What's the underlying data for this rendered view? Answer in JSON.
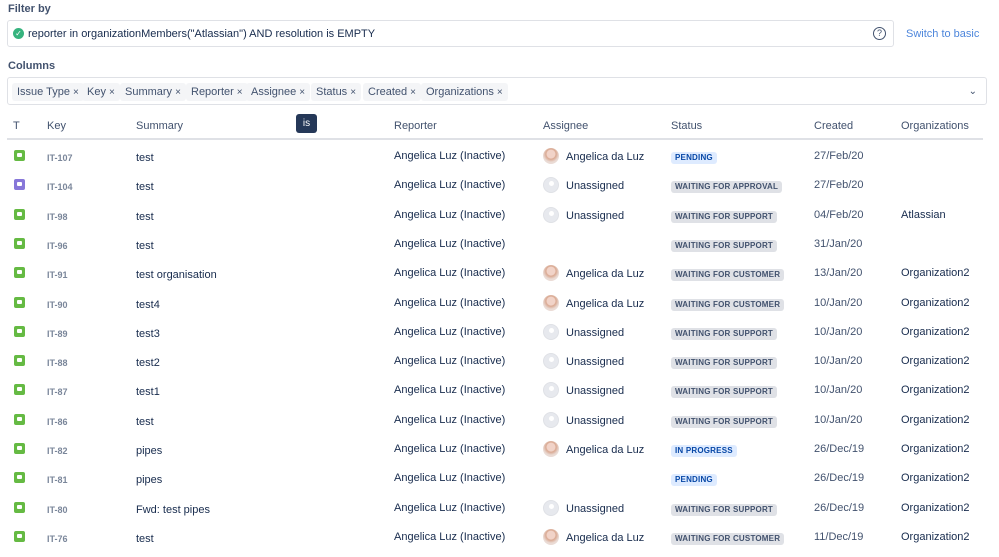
{
  "filter": {
    "label": "Filter by",
    "query": "reporter in organizationMembers(\"Atlassian\") AND resolution is EMPTY",
    "help_icon": "question-circle-icon",
    "switch_label": "Switch to basic"
  },
  "columns": {
    "label": "Columns",
    "chips": [
      "Issue Type",
      "Key",
      "Summary",
      "Reporter",
      "Assignee",
      "Status",
      "Created",
      "Organizations"
    ],
    "remove_glyph": "×"
  },
  "tooltip": {
    "text": "is"
  },
  "table": {
    "headers": {
      "type": "T",
      "key": "Key",
      "summary": "Summary",
      "reporter": "Reporter",
      "assignee": "Assignee",
      "status": "Status",
      "created": "Created",
      "organizations": "Organizations"
    },
    "rows": [
      {
        "type": "green",
        "key": "IT-107",
        "summary": "test",
        "reporter": "Angelica Luz (Inactive)",
        "assignee": "Angelica da Luz",
        "avatar": "photo",
        "status": "PENDING",
        "status_color": "blue",
        "created": "27/Feb/20",
        "organization": ""
      },
      {
        "type": "purple",
        "key": "IT-104",
        "summary": "test",
        "reporter": "Angelica Luz (Inactive)",
        "assignee": "Unassigned",
        "avatar": "default",
        "status": "WAITING FOR APPROVAL",
        "status_color": "grey",
        "created": "27/Feb/20",
        "organization": ""
      },
      {
        "type": "green",
        "key": "IT-98",
        "summary": "test",
        "reporter": "Angelica Luz (Inactive)",
        "assignee": "Unassigned",
        "avatar": "default",
        "status": "WAITING FOR SUPPORT",
        "status_color": "grey",
        "created": "04/Feb/20",
        "organization": "Atlassian"
      },
      {
        "type": "green",
        "key": "IT-96",
        "summary": "test",
        "reporter": "Angelica Luz (Inactive)",
        "assignee": "",
        "avatar": "none",
        "status": "WAITING FOR SUPPORT",
        "status_color": "grey",
        "created": "31/Jan/20",
        "organization": ""
      },
      {
        "type": "green",
        "key": "IT-91",
        "summary": "test organisation",
        "reporter": "Angelica Luz (Inactive)",
        "assignee": "Angelica da Luz",
        "avatar": "photo",
        "status": "WAITING FOR CUSTOMER",
        "status_color": "grey",
        "created": "13/Jan/20",
        "organization": "Organization2"
      },
      {
        "type": "green",
        "key": "IT-90",
        "summary": "test4",
        "reporter": "Angelica Luz (Inactive)",
        "assignee": "Angelica da Luz",
        "avatar": "photo",
        "status": "WAITING FOR CUSTOMER",
        "status_color": "grey",
        "created": "10/Jan/20",
        "organization": "Organization2"
      },
      {
        "type": "green",
        "key": "IT-89",
        "summary": "test3",
        "reporter": "Angelica Luz (Inactive)",
        "assignee": "Unassigned",
        "avatar": "default",
        "status": "WAITING FOR SUPPORT",
        "status_color": "grey",
        "created": "10/Jan/20",
        "organization": "Organization2"
      },
      {
        "type": "green",
        "key": "IT-88",
        "summary": "test2",
        "reporter": "Angelica Luz (Inactive)",
        "assignee": "Unassigned",
        "avatar": "default",
        "status": "WAITING FOR SUPPORT",
        "status_color": "grey",
        "created": "10/Jan/20",
        "organization": "Organization2"
      },
      {
        "type": "green",
        "key": "IT-87",
        "summary": "test1",
        "reporter": "Angelica Luz (Inactive)",
        "assignee": "Unassigned",
        "avatar": "default",
        "status": "WAITING FOR SUPPORT",
        "status_color": "grey",
        "created": "10/Jan/20",
        "organization": "Organization2"
      },
      {
        "type": "green",
        "key": "IT-86",
        "summary": "test",
        "reporter": "Angelica Luz (Inactive)",
        "assignee": "Unassigned",
        "avatar": "default",
        "status": "WAITING FOR SUPPORT",
        "status_color": "grey",
        "created": "10/Jan/20",
        "organization": "Organization2"
      },
      {
        "type": "green",
        "key": "IT-82",
        "summary": "pipes",
        "reporter": "Angelica Luz (Inactive)",
        "assignee": "Angelica da Luz",
        "avatar": "photo",
        "status": "IN PROGRESS",
        "status_color": "blue",
        "created": "26/Dec/19",
        "organization": "Organization2"
      },
      {
        "type": "green",
        "key": "IT-81",
        "summary": "pipes",
        "reporter": "Angelica Luz (Inactive)",
        "assignee": "",
        "avatar": "none",
        "status": "PENDING",
        "status_color": "blue",
        "created": "26/Dec/19",
        "organization": "Organization2"
      },
      {
        "type": "green",
        "key": "IT-80",
        "summary": "Fwd: test pipes",
        "reporter": "Angelica Luz (Inactive)",
        "assignee": "Unassigned",
        "avatar": "default",
        "status": "WAITING FOR SUPPORT",
        "status_color": "grey",
        "created": "26/Dec/19",
        "organization": "Organization2"
      },
      {
        "type": "green",
        "key": "IT-76",
        "summary": "test",
        "reporter": "Angelica Luz (Inactive)",
        "assignee": "Angelica da Luz",
        "avatar": "photo",
        "status": "WAITING FOR CUSTOMER",
        "status_color": "grey",
        "created": "11/Dec/19",
        "organization": "Organization2"
      }
    ]
  }
}
